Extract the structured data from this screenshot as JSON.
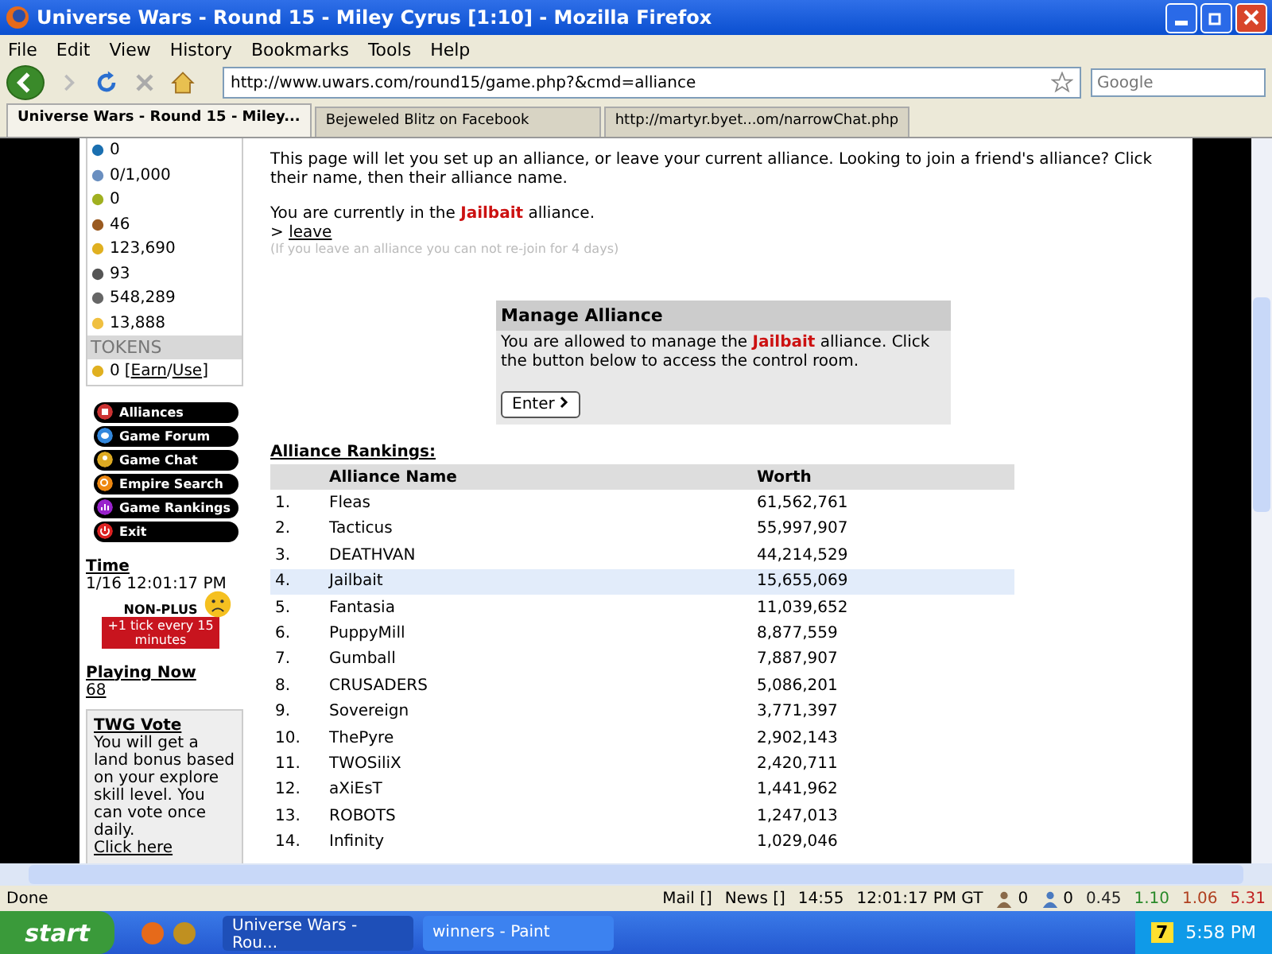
{
  "window": {
    "title": "Universe Wars - Round 15 - Miley Cyrus [1:10] - Mozilla Firefox"
  },
  "menu": [
    "File",
    "Edit",
    "View",
    "History",
    "Bookmarks",
    "Tools",
    "Help"
  ],
  "address": "http://www.uwars.com/round15/game.php?&cmd=alliance",
  "search": {
    "placeholder": "Google"
  },
  "tabs": [
    {
      "label": "Universe Wars - Round 15 - Miley...",
      "selected": true
    },
    {
      "label": "Bejeweled Blitz on Facebook",
      "selected": false
    },
    {
      "label": "http://martyr.byet...om/narrowChat.php",
      "selected": false
    }
  ],
  "sidebar": {
    "resources": [
      {
        "kind": "globe",
        "value": "0"
      },
      {
        "kind": "people",
        "value": "0/1,000"
      },
      {
        "kind": "food",
        "value": "0"
      },
      {
        "kind": "wood",
        "value": "46"
      },
      {
        "kind": "gold",
        "value": "123,690"
      },
      {
        "kind": "pencil",
        "value": "93"
      },
      {
        "kind": "barrel",
        "value": "548,289"
      },
      {
        "kind": "bulb",
        "value": "13,888"
      }
    ],
    "tokens_heading": "TOKENS",
    "tokens_value": "0",
    "bracket_open": "[",
    "earn_link": "Earn",
    "separator": "/",
    "use_link": "Use",
    "bracket_close": "]",
    "nav": [
      {
        "kind": "alliances",
        "label": "Alliances",
        "color": "#cc3333"
      },
      {
        "kind": "forum",
        "label": "Game Forum",
        "color": "#3388dd"
      },
      {
        "kind": "chat",
        "label": "Game Chat",
        "color": "#ddaa22"
      },
      {
        "kind": "search",
        "label": "Empire Search",
        "color": "#ee8811"
      },
      {
        "kind": "rankings",
        "label": "Game Rankings",
        "color": "#9922cc"
      },
      {
        "kind": "exit",
        "label": "Exit",
        "color": "#dd2222"
      }
    ],
    "time_label": "Time",
    "time_value": "1/16 12:01:17 PM",
    "badge": {
      "title": "NON-PLUS",
      "text": "+1 tick every 15 minutes"
    },
    "playing_label": "Playing Now",
    "playing_value": "68",
    "vote": {
      "title": "TWG Vote",
      "text": "You will get a land bonus based on your explore skill level. You can vote once daily.",
      "link": "Click here"
    }
  },
  "main": {
    "intro": "This page will let you set up an alliance, or leave your current alliance. Looking to join a friend's alliance? Click their name, then their alliance name.",
    "current": "You are currently in the **Jailbait** alliance.",
    "leave_arrow": ">",
    "leave_link": "leave",
    "leave_note": "(If you leave an alliance you can not re-join for 4 days)",
    "manage": {
      "title": "Manage Alliance",
      "text": "You are allowed to manage the **Jailbait** alliance. Click the button below to access the control room.",
      "button": "Enter"
    },
    "rankings_title": "Alliance Rankings:",
    "table": {
      "columns": [
        "Alliance Name",
        "Worth"
      ],
      "rows": [
        {
          "rank": "1.",
          "name": "Fleas",
          "worth": "61,562,761",
          "selected": false
        },
        {
          "rank": "2.",
          "name": "Tacticus",
          "worth": "55,997,907",
          "selected": false
        },
        {
          "rank": "3.",
          "name": "DEATHVAN",
          "worth": "44,214,529",
          "selected": false
        },
        {
          "rank": "4.",
          "name": "Jailbait",
          "worth": "15,655,069",
          "selected": true
        },
        {
          "rank": "5.",
          "name": "Fantasia",
          "worth": "11,039,652",
          "selected": false
        },
        {
          "rank": "6.",
          "name": "PuppyMill",
          "worth": "8,877,559",
          "selected": false
        },
        {
          "rank": "7.",
          "name": "Gumball",
          "worth": "7,887,907",
          "selected": false
        },
        {
          "rank": "8.",
          "name": "CRUSADERS",
          "worth": "5,086,201",
          "selected": false
        },
        {
          "rank": "9.",
          "name": "Sovereign",
          "worth": "3,771,397",
          "selected": false
        },
        {
          "rank": "10.",
          "name": "ThePyre",
          "worth": "2,902,143",
          "selected": false
        },
        {
          "rank": "11.",
          "name": "TWOSiliX",
          "worth": "2,420,711",
          "selected": false
        },
        {
          "rank": "12.",
          "name": "aXiEsT",
          "worth": "1,441,962",
          "selected": false
        },
        {
          "rank": "13.",
          "name": "ROBOTS",
          "worth": "1,247,013",
          "selected": false
        },
        {
          "rank": "14.",
          "name": "Infinity",
          "worth": "1,029,046",
          "selected": false
        }
      ]
    }
  },
  "status_bar": {
    "text": "Done",
    "items": [
      "Mail []",
      "News []",
      "14:55",
      "12:01:17 PM GT"
    ],
    "counters": [
      {
        "kind": "person",
        "value": "0"
      },
      {
        "kind": "people",
        "value": "0"
      }
    ],
    "rates": [
      {
        "value": "0.45",
        "color": "#222222"
      },
      {
        "value": "1.10",
        "color": "#2a8a2a"
      },
      {
        "value": "1.06",
        "color": "#b04020"
      },
      {
        "value": "5.31",
        "color": "#c02020"
      }
    ]
  },
  "taskbar": {
    "start": "start",
    "items": [
      {
        "label": "Universe Wars - Rou...",
        "selected": true
      },
      {
        "label": "winners - Paint",
        "selected": false
      }
    ],
    "tray_badge": "7",
    "clock": "5:58 PM"
  }
}
